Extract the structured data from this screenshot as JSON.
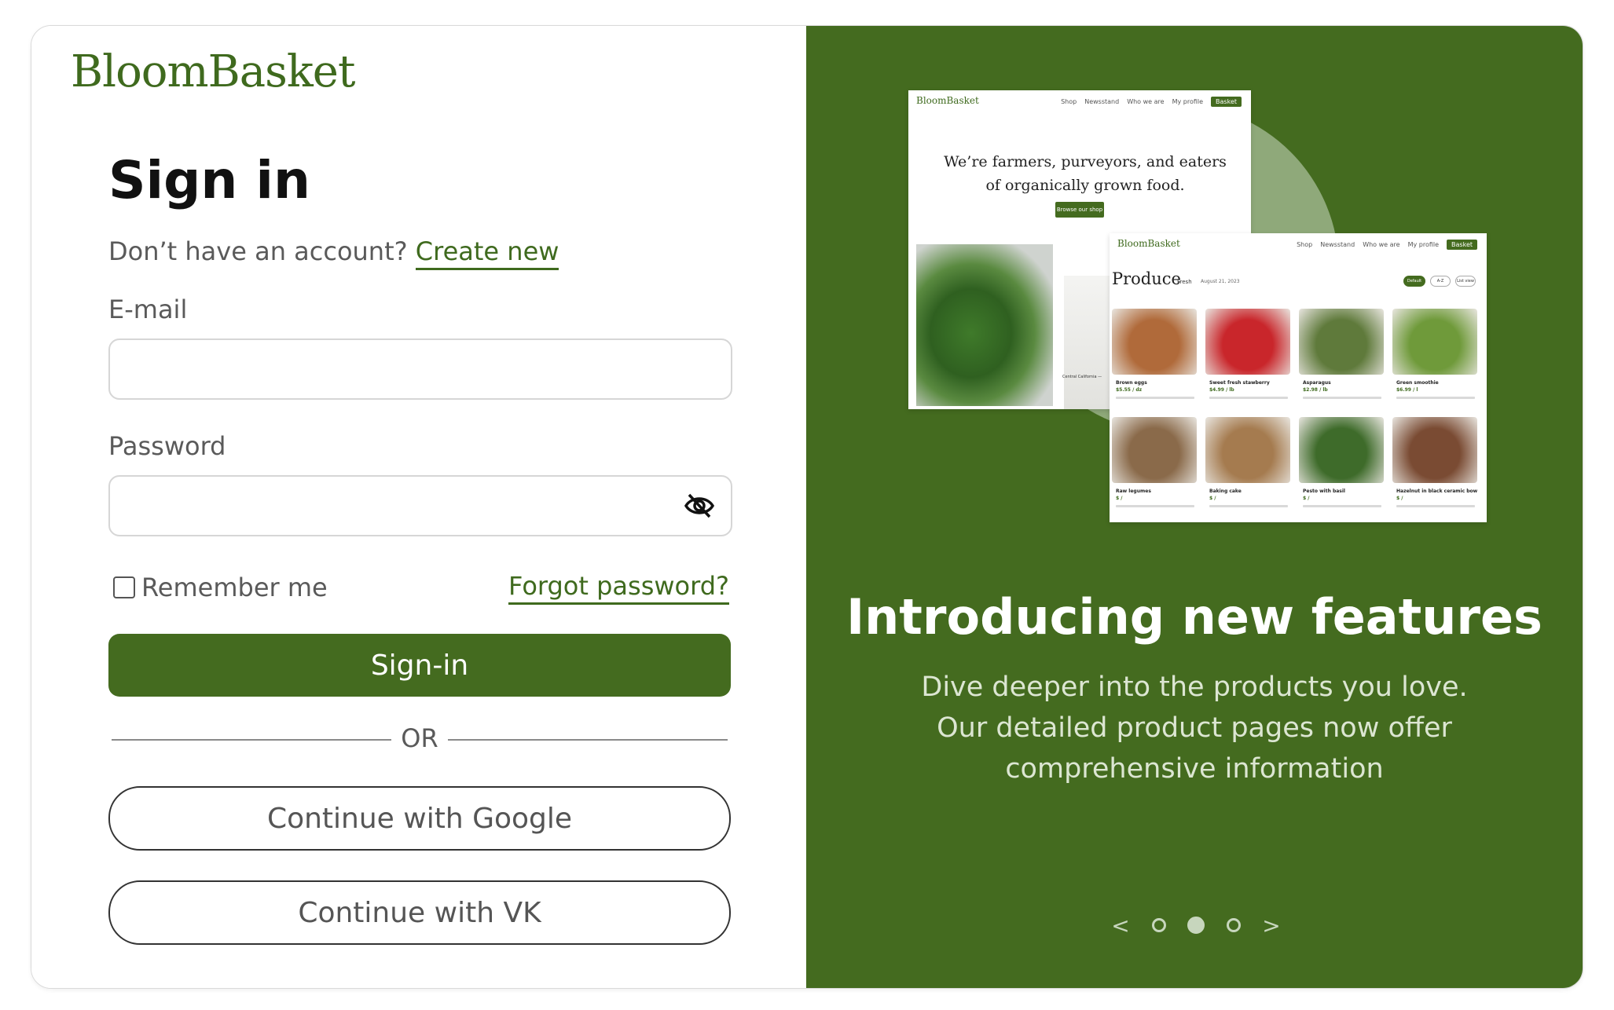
{
  "brand": {
    "logo_text": "BloomBasket",
    "accent_color": "#446b1f"
  },
  "signin": {
    "title": "Sign in",
    "account_prompt": "Don’t have an account?",
    "create_link": "Create new",
    "email_label": "E-mail",
    "email_value": "",
    "password_label": "Password",
    "password_value": "",
    "remember_label": "Remember me",
    "remember_checked": false,
    "forgot_link": "Forgot password?",
    "submit_label": "Sign-in",
    "or_text": "OR",
    "google_button": "Continue with Google",
    "vk_button": "Continue with VK"
  },
  "promo": {
    "headline": "Introducing new features",
    "description_lines": [
      "Dive deeper into the products you love.",
      "Our detailed product pages now offer",
      "comprehensive information"
    ],
    "carousel": {
      "prev": "<",
      "next": ">",
      "active_index": 1,
      "total": 3
    }
  },
  "mockup_home": {
    "logo": "BloomBasket",
    "nav": [
      "Shop",
      "Newsstand",
      "Who we are",
      "My profile"
    ],
    "basket": "Basket",
    "hero_line1": "We’re farmers, purveyors, and eaters",
    "hero_line2": "of organically grown food.",
    "hero_button": "Browse our shop",
    "caption": "Central California — "
  },
  "mockup_produce": {
    "logo": "BloomBasket",
    "nav": [
      "Shop",
      "Newsstand",
      "Who we are",
      "My profile"
    ],
    "basket": "Basket",
    "heading": "Produce",
    "tag": "Fresh",
    "date": "August 21, 2023",
    "filters": [
      "Default",
      "A-Z",
      "List view"
    ],
    "items": [
      {
        "name": "Brown eggs",
        "price": "$5.55 / dz",
        "color": "#b06a3a"
      },
      {
        "name": "Sweet fresh stawberry",
        "price": "$4.99 / lb",
        "color": "#c9262b"
      },
      {
        "name": "Asparagus",
        "price": "$2.98 / lb",
        "color": "#5f7a3b"
      },
      {
        "name": "Green smoothie",
        "price": "$6.99 / l",
        "color": "#6f9a3a"
      },
      {
        "name": "Raw legumes",
        "price": "$ /",
        "color": "#8a6a4a"
      },
      {
        "name": "Baking cake",
        "price": "$ /",
        "color": "#a57b4f"
      },
      {
        "name": "Pesto with basil",
        "price": "$ /",
        "color": "#3e6b2a"
      },
      {
        "name": "Hazelnut in black ceramic bow",
        "price": "$ /",
        "color": "#7a4b33"
      }
    ]
  }
}
